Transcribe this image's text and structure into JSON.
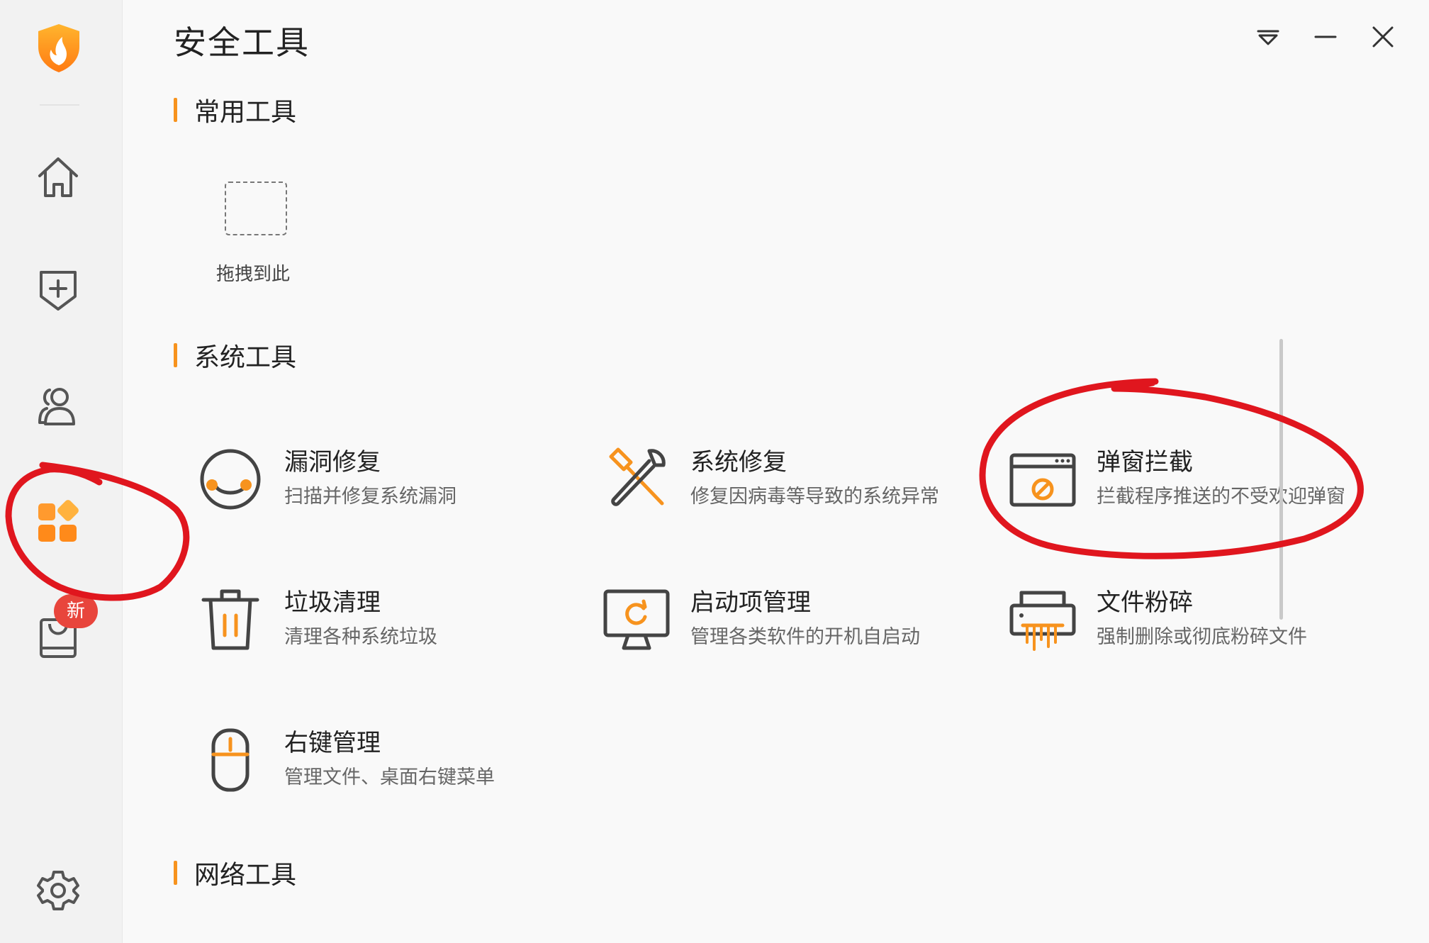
{
  "app": {
    "title": "安全工具"
  },
  "sidebar": {
    "badge": "新"
  },
  "sections": {
    "common": "常用工具",
    "system": "系统工具",
    "network": "网络工具"
  },
  "drop_zone": {
    "label": "拖拽到此"
  },
  "tools": [
    {
      "name": "漏洞修复",
      "desc": "扫描并修复系统漏洞"
    },
    {
      "name": "系统修复",
      "desc": "修复因病毒等导致的系统异常"
    },
    {
      "name": "弹窗拦截",
      "desc": "拦截程序推送的不受欢迎弹窗"
    },
    {
      "name": "垃圾清理",
      "desc": "清理各种系统垃圾"
    },
    {
      "name": "启动项管理",
      "desc": "管理各类软件的开机自启动"
    },
    {
      "name": "文件粉碎",
      "desc": "强制删除或彻底粉碎文件"
    },
    {
      "name": "右键管理",
      "desc": "管理文件、桌面右键菜单"
    }
  ],
  "colors": {
    "accent": "#f7931e",
    "annotation": "#e0161e",
    "badge": "#e8453c"
  }
}
